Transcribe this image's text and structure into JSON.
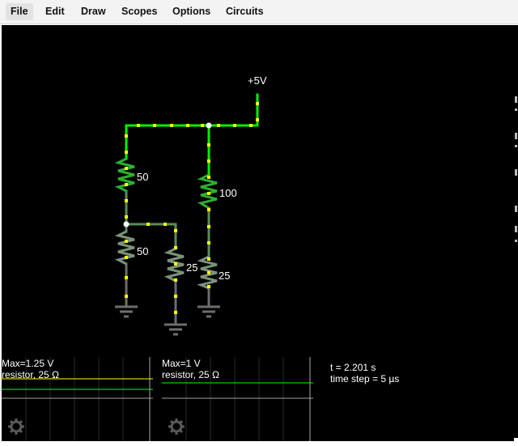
{
  "menu": {
    "items": [
      {
        "label": "File",
        "active": true
      },
      {
        "label": "Edit"
      },
      {
        "label": "Draw"
      },
      {
        "label": "Scopes"
      },
      {
        "label": "Options"
      },
      {
        "label": "Circuits"
      }
    ]
  },
  "circuit": {
    "supply_label": "+5V",
    "resistors": [
      {
        "id": "r1",
        "label": "50"
      },
      {
        "id": "r2",
        "label": "50"
      },
      {
        "id": "r3",
        "label": "25"
      },
      {
        "id": "r4",
        "label": "100"
      },
      {
        "id": "r5",
        "label": "25"
      }
    ],
    "colors": {
      "background": "#000000",
      "wire_high": "#00ee00",
      "wire_mid": "#5c8c5c",
      "wire_low": "#6e6e6e",
      "current_dot": "#ffff00",
      "node": "#ffffff"
    }
  },
  "scopes": [
    {
      "max_label": "Max=1.25 V",
      "name_label": "resistor, 25 Ω",
      "trace_colors": [
        "#ffff00",
        "#00ff00"
      ]
    },
    {
      "max_label": "Max=1 V",
      "name_label": "resistor, 25 Ω",
      "trace_colors": [
        "#00ff00"
      ]
    }
  ],
  "sim_info": {
    "time": "t = 2.201 s",
    "time_step": "time step = 5 µs"
  },
  "icons": {
    "scope_settings": "gear-icon"
  }
}
